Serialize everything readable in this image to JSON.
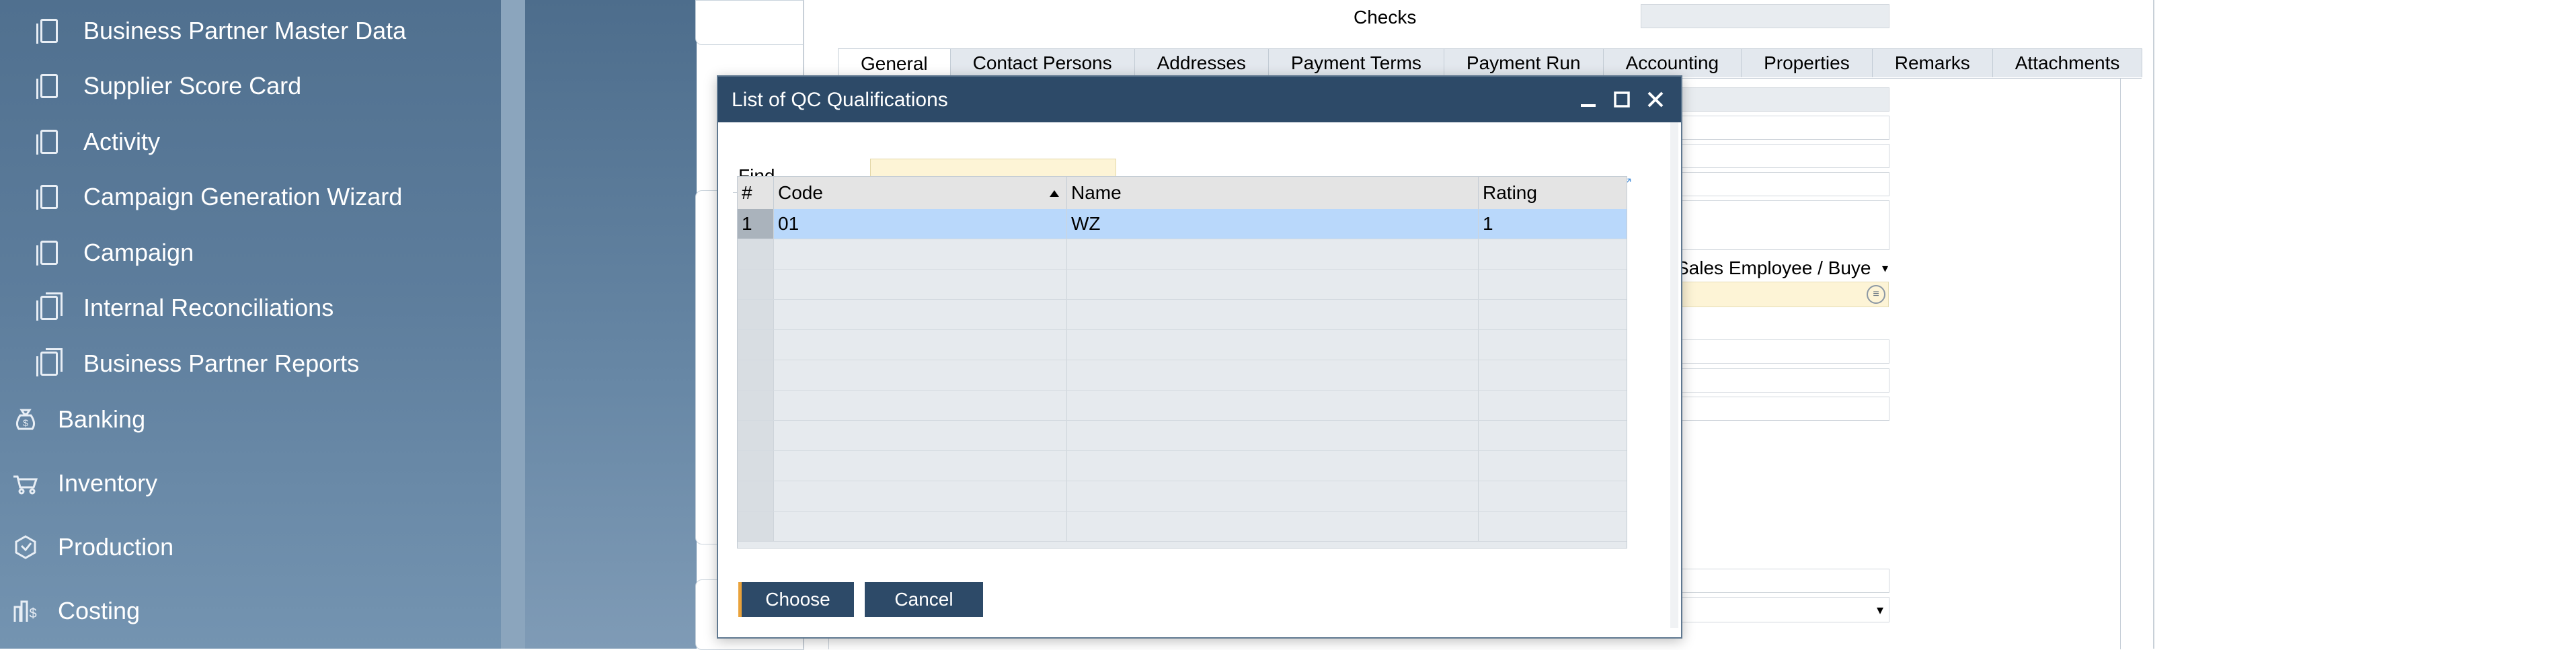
{
  "sidebar": {
    "sub_items": [
      {
        "label": "Business Partner Master Data",
        "icon": "document-icon"
      },
      {
        "label": "Supplier Score Card",
        "icon": "document-icon"
      },
      {
        "label": "Activity",
        "icon": "document-icon"
      },
      {
        "label": "Campaign Generation Wizard",
        "icon": "document-icon"
      },
      {
        "label": "Campaign",
        "icon": "document-icon"
      },
      {
        "label": "Internal Reconciliations",
        "icon": "folder-icon"
      },
      {
        "label": "Business Partner Reports",
        "icon": "folder-icon"
      }
    ],
    "modules": [
      {
        "label": "Banking",
        "icon": "money-bag-icon"
      },
      {
        "label": "Inventory",
        "icon": "cart-icon"
      },
      {
        "label": "Production",
        "icon": "production-icon"
      },
      {
        "label": "Costing",
        "icon": "costing-icon"
      }
    ]
  },
  "background_form": {
    "checks_label": "Checks",
    "tabs": [
      "General",
      "Contact Persons",
      "Addresses",
      "Payment Terms",
      "Payment Run",
      "Accounting",
      "Properties",
      "Remarks",
      "Attachments"
    ],
    "active_tab": "General",
    "sales_employee_label": "Sales Employee / Buyer"
  },
  "dialog": {
    "title": "List of QC Qualifications",
    "find_label": "Find",
    "find_value": "",
    "columns": {
      "rownum": "#",
      "code": "Code",
      "name": "Name",
      "rating": "Rating"
    },
    "rows": [
      {
        "num": "1",
        "code": "01",
        "name": "WZ",
        "rating": "1"
      }
    ],
    "choose_label": "Choose",
    "cancel_label": "Cancel"
  },
  "colors": {
    "titlebar": "#2d4a68",
    "selected_row": "#b9d8fb",
    "find_field": "#fdf4d6",
    "choose_accent": "#e9a23b"
  }
}
